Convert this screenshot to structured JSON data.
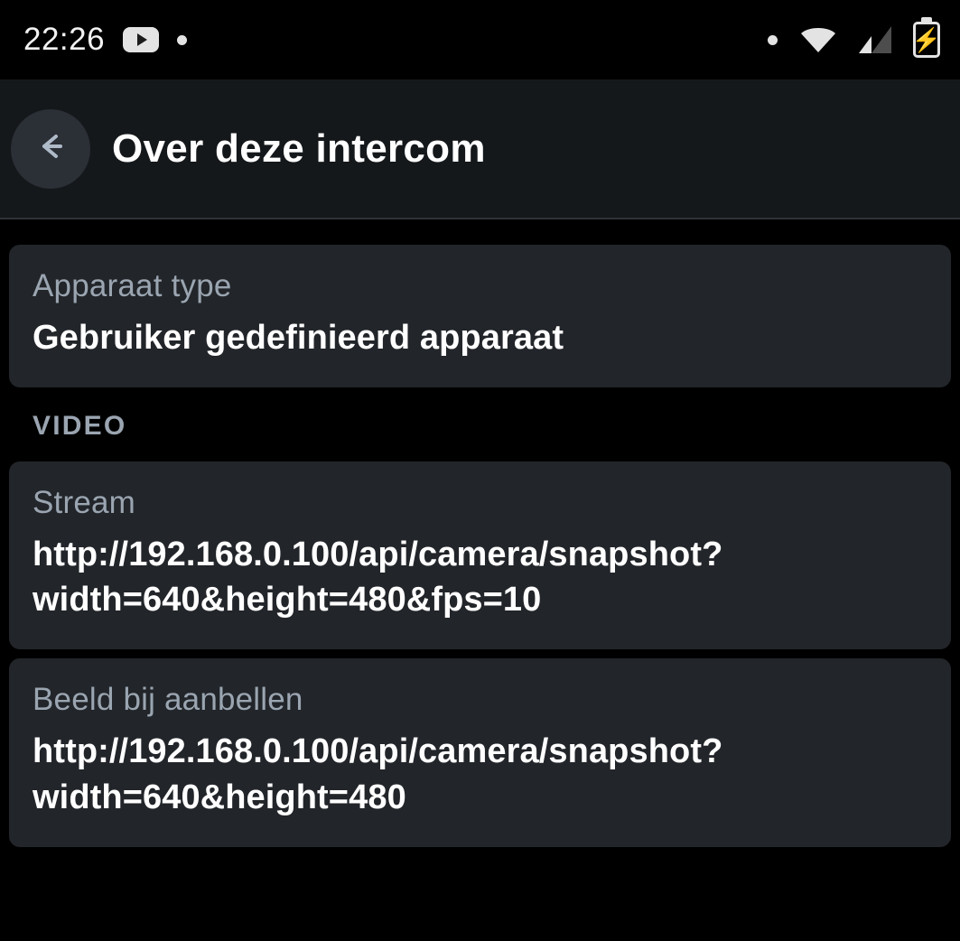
{
  "status_bar": {
    "time": "22:26",
    "icons": [
      {
        "name": "youtube-icon"
      },
      {
        "name": "notification-dot-icon"
      },
      {
        "name": "status-dot-icon"
      },
      {
        "name": "wifi-icon"
      },
      {
        "name": "cellular-signal-icon"
      },
      {
        "name": "battery-charging-icon"
      }
    ]
  },
  "app_bar": {
    "back_label": "Terug",
    "title": "Over deze intercom"
  },
  "content": {
    "device_card": {
      "label": "Apparaat type",
      "value": "Gebruiker gedefinieerd apparaat"
    },
    "video_section": {
      "header": "VIDEO",
      "items": [
        {
          "label": "Stream",
          "value": "http://192.168.0.100/api/camera/snapshot?width=640&height=480&fps=10"
        },
        {
          "label": "Beeld bij aanbellen",
          "value": "http://192.168.0.100/api/camera/snapshot?width=640&height=480"
        }
      ]
    }
  },
  "colors": {
    "page_background": "#000000",
    "app_bar_background": "#15181b",
    "card_background": "#222529",
    "label_text": "#9aa5b1",
    "value_text": "#ffffff",
    "back_button_background": "#2b2f36",
    "back_arrow": "#aebac7",
    "divider": "#2e3338"
  }
}
